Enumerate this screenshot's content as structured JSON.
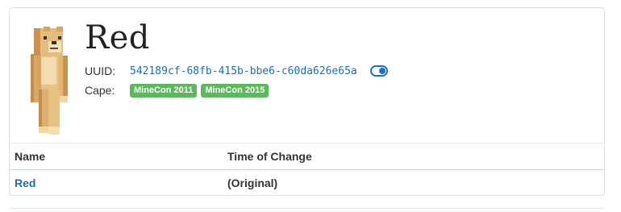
{
  "profile": {
    "name": "Red",
    "uuid_label": "UUID:",
    "uuid": "542189cf-68fb-415b-bbe6-c60da626e65a",
    "cape_label": "Cape:",
    "capes": [
      "MineCon 2011",
      "MineCon 2015"
    ],
    "avatar_icon": "doge-skin-avatar",
    "toggle_icon": "toggle-switch-icon"
  },
  "history": {
    "headers": [
      "Name",
      "Time of Change"
    ],
    "rows": [
      {
        "name": "Red",
        "time": "(Original)"
      }
    ]
  },
  "colors": {
    "link": "#1a6fb7",
    "badge": "#5cb85c",
    "border": "#dfe1e5"
  }
}
